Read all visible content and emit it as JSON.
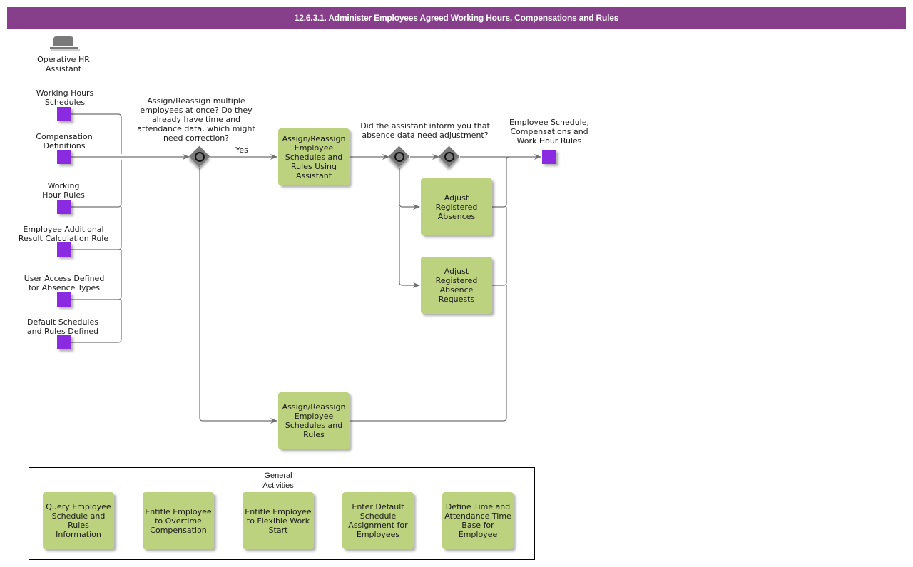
{
  "title": "12.6.3.1. Administer Employees Agreed Working Hours, Compensations and Rules",
  "colors": {
    "title_bar": "#873f8c",
    "data_object": "#8a2be2",
    "task": "#bcd27e",
    "gateway": "#7a7a7a",
    "connector": "#707070"
  },
  "actor": {
    "icon": "hat-icon",
    "label": "Operative HR\nAssistant"
  },
  "inputs": [
    {
      "label": "Working Hours\nSchedules"
    },
    {
      "label": "Compensation\nDefinitions"
    },
    {
      "label": "Working\nHour Rules"
    },
    {
      "label": "Employee Additional\nResult Calculation Rule"
    },
    {
      "label": "User Access Defined\nfor Absence Types"
    },
    {
      "label": "Default Schedules\nand Rules Defined"
    }
  ],
  "gateway1": {
    "question": "Assign/Reassign multiple\nemployees at once? Do they\nalready have time and\nattendance data, which might\nneed correction?",
    "yes_label": "Yes"
  },
  "gateway2": {
    "question": "Did the assistant inform you that\nabsence data need adjustment?"
  },
  "tasks": {
    "assign_using_assistant": "Assign/Reassign\nEmployee\nSchedules and\nRules Using\nAssistant",
    "adjust_absences": "Adjust\nRegistered\nAbsences",
    "adjust_absence_requests": "Adjust\nRegistered\nAbsence\nRequests",
    "assign_reassign": "Assign/Reassign\nEmployee\nSchedules and\nRules"
  },
  "output": {
    "label": "Employee Schedule,\nCompensations and\nWork Hour Rules"
  },
  "general_activities": {
    "label": "General\nActivities",
    "items": [
      "Query Employee\nSchedule and\nRules\nInformation",
      "Entitle Employee\nto Overtime\nCompensation",
      "Entitle Employee\nto Flexible Work\nStart",
      "Enter Default\nSchedule\nAssignment for\nEmployees",
      "Define Time and\nAttendance Time\nBase for\nEmployee"
    ]
  }
}
